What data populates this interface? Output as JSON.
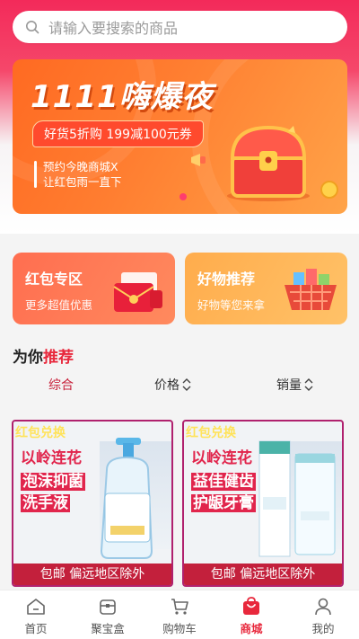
{
  "search": {
    "placeholder": "请输入要搜索的商品",
    "icon": "search-icon"
  },
  "banner": {
    "title": "1111嗨爆夜",
    "coupon": "好货5折购 199减100元券",
    "promo_line1": "预约今晚商城X",
    "promo_line2": "让红包雨一直下"
  },
  "cards": [
    {
      "title": "红包专区",
      "subtitle": "更多超值优惠"
    },
    {
      "title": "好物推荐",
      "subtitle": "好物等您来拿"
    }
  ],
  "section": {
    "prefix": "为你",
    "highlight": "推荐"
  },
  "tabs": [
    {
      "label": "综合"
    },
    {
      "label": "价格"
    },
    {
      "label": "销量"
    }
  ],
  "products": [
    {
      "badge": "红包兑换",
      "brand_line": "以岭连花",
      "line2": "泡沫抑菌",
      "line3": "洗手液",
      "footer": "包邮 偏远地区除外"
    },
    {
      "badge": "红包兑换",
      "brand_line": "以岭连花",
      "line2": "益佳健齿",
      "line3": "护龈牙膏",
      "footer": "包邮 偏远地区除外"
    }
  ],
  "tabbar": [
    {
      "label": "首页",
      "icon": "home-icon"
    },
    {
      "label": "聚宝盒",
      "icon": "box-icon"
    },
    {
      "label": "购物车",
      "icon": "cart-icon"
    },
    {
      "label": "商城",
      "icon": "shop-bag-icon"
    },
    {
      "label": "我的",
      "icon": "user-icon"
    }
  ],
  "colors": {
    "accent": "#e8283c",
    "header": "#f32a5a",
    "banner": "#ff7d30"
  }
}
